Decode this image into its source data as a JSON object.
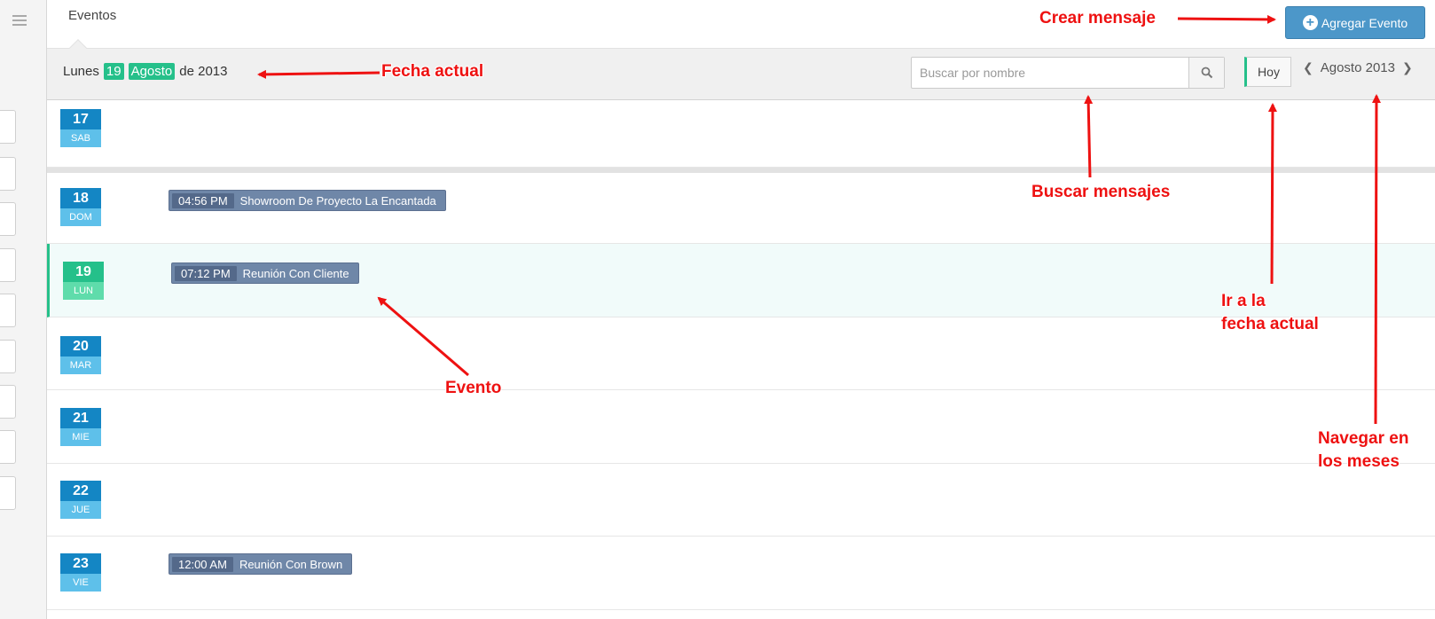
{
  "header": {
    "title": "Eventos",
    "add_button_label": "Agregar Evento"
  },
  "toolbar": {
    "date_weekday": "Lunes",
    "date_day": "19",
    "date_month": "Agosto",
    "date_year": "de 2013",
    "search_placeholder": "Buscar por nombre",
    "today_label": "Hoy",
    "month_label": "Agosto 2013"
  },
  "days": [
    {
      "num": "17",
      "day": "SAB"
    },
    {
      "num": "18",
      "day": "DOM"
    },
    {
      "num": "19",
      "day": "LUN"
    },
    {
      "num": "20",
      "day": "MAR"
    },
    {
      "num": "21",
      "day": "MIE"
    },
    {
      "num": "22",
      "day": "JUE"
    },
    {
      "num": "23",
      "day": "VIE"
    }
  ],
  "events": [
    {
      "time": "04:56 PM",
      "title": "Showroom De Proyecto La Encantada"
    },
    {
      "time": "07:12 PM",
      "title": "Reunión Con Cliente"
    },
    {
      "time": "12:00 AM",
      "title": "Reunión Con Brown"
    }
  ],
  "annotations": {
    "crear": "Crear mensaje",
    "fecha": "Fecha actual",
    "buscar": "Buscar mensajes",
    "ir_line1": "Ir a la",
    "ir_line2": "fecha actual",
    "navegar_line1": "Navegar en",
    "navegar_line2": "los meses",
    "evento": "Evento"
  },
  "colors": {
    "accent_green": "#25c08a",
    "day_blue": "#1486c4",
    "event_slate": "#6f87a8",
    "annotation_red": "#ee1111"
  }
}
